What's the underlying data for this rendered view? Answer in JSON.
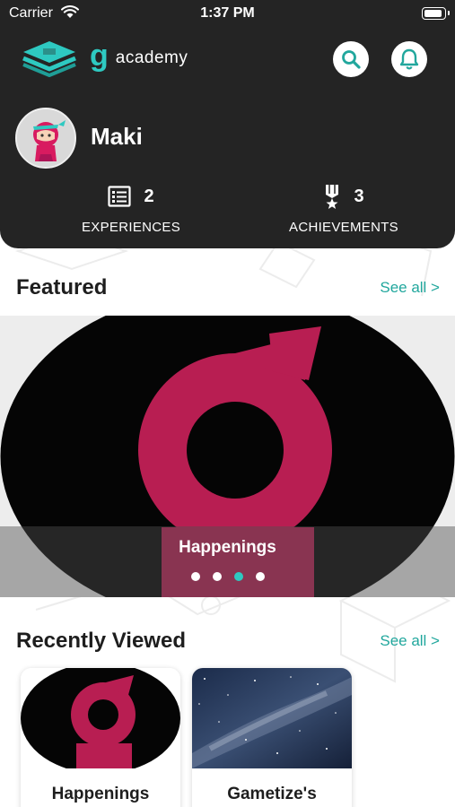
{
  "status_bar": {
    "carrier": "Carrier",
    "time": "1:37 PM",
    "battery_level": 0.92
  },
  "brand": {
    "letter": "g",
    "name": "academy"
  },
  "profile": {
    "name": "Maki"
  },
  "stats": {
    "experiences": {
      "count": "2",
      "label": "EXPERIENCES"
    },
    "achievements": {
      "count": "3",
      "label": "ACHIEVEMENTS"
    }
  },
  "featured": {
    "title": "Featured",
    "see_all": "See all >",
    "item_label": "Happenings",
    "slide_count": 4,
    "active_slide": 3
  },
  "recently_viewed": {
    "title": "Recently Viewed",
    "see_all": "See all >",
    "cards": [
      {
        "label": "Happenings"
      },
      {
        "label": "Gametize's"
      }
    ]
  },
  "colors": {
    "header_bg": "#242424",
    "accent": "#2ec9c1",
    "link": "#21a79d",
    "brand_magenta": "#c2185b"
  }
}
